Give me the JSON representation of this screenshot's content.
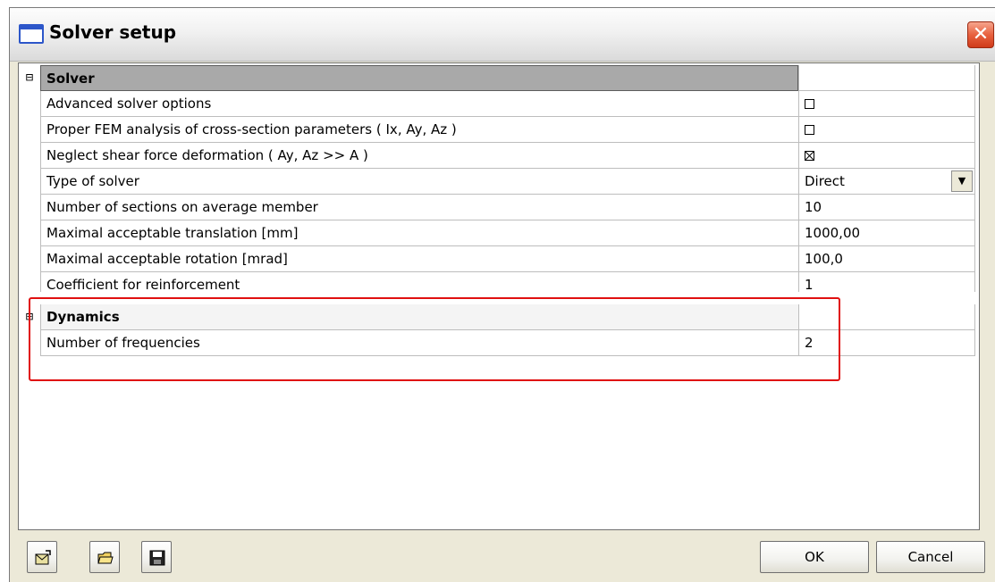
{
  "window": {
    "title": "Solver setup",
    "close_glyph": "✕"
  },
  "grid": {
    "groups": [
      {
        "expander": "⊟",
        "title": "Solver",
        "rows": [
          {
            "label": "Advanced solver options",
            "value_type": "checkbox",
            "checked": false
          },
          {
            "label": "Proper FEM analysis of cross-section parameters ( Ix, Ay, Az )",
            "value_type": "checkbox",
            "checked": false
          },
          {
            "label": "Neglect shear force deformation ( Ay, Az >> A )",
            "value_type": "checkbox",
            "checked": true
          },
          {
            "label": "Type of solver",
            "value_type": "dropdown",
            "value": "Direct"
          },
          {
            "label": "Number of sections on average member",
            "value_type": "text",
            "value": "10"
          },
          {
            "label": "Maximal acceptable translation [mm]",
            "value_type": "text",
            "value": "1000,00"
          },
          {
            "label": "Maximal acceptable rotation [mrad]",
            "value_type": "text",
            "value": "100,0"
          },
          {
            "label": "Coefficient for reinforcement",
            "value_type": "text",
            "value": "1"
          }
        ]
      },
      {
        "expander": "⊟",
        "title": "Dynamics",
        "rows": [
          {
            "label": "Number of frequencies",
            "value_type": "text",
            "value": "2"
          }
        ]
      }
    ]
  },
  "footer": {
    "icon_buttons": [
      "export-icon",
      "open-folder-icon",
      "save-disk-icon"
    ],
    "ok_label": "OK",
    "cancel_label": "Cancel"
  },
  "colors": {
    "highlight": "#e01010",
    "header_bg": "#a9a9a9",
    "window_bg": "#ece9d8"
  }
}
